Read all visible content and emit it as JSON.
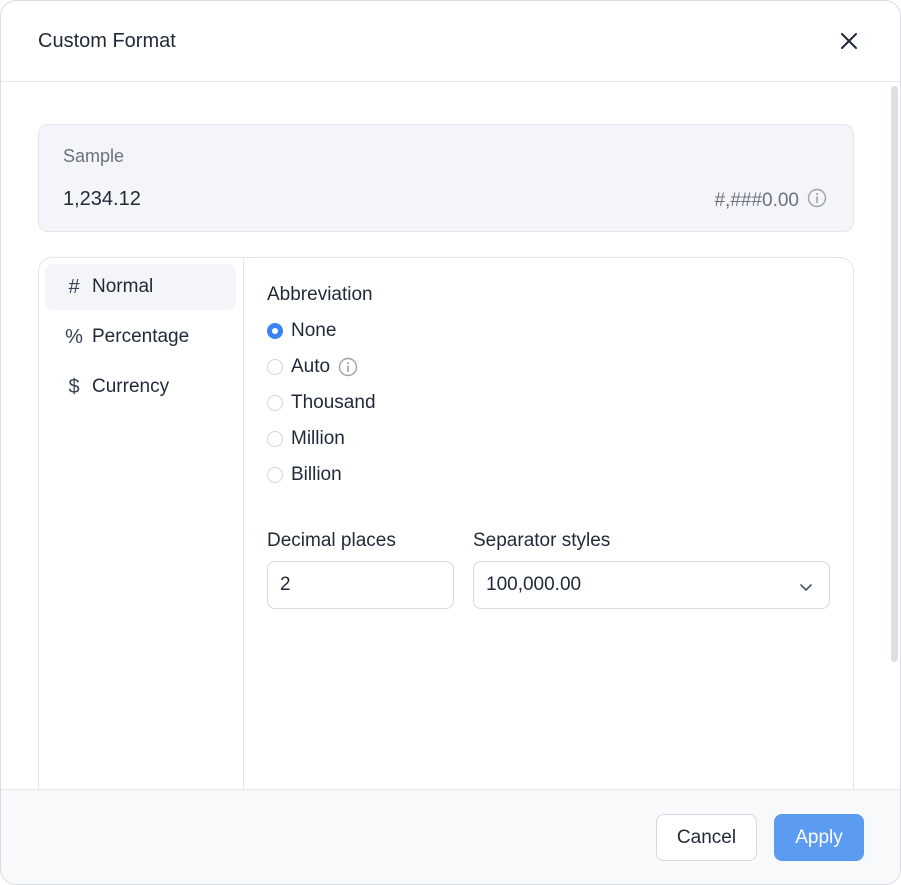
{
  "dialog": {
    "title": "Custom Format"
  },
  "sample": {
    "label": "Sample",
    "value": "1,234.12",
    "format": "#,###0.00"
  },
  "sidebar": {
    "items": [
      {
        "icon": "#",
        "label": "Normal",
        "active": true
      },
      {
        "icon": "%",
        "label": "Percentage",
        "active": false
      },
      {
        "icon": "$",
        "label": "Currency",
        "active": false
      }
    ]
  },
  "abbreviation": {
    "title": "Abbreviation",
    "options": [
      {
        "label": "None",
        "checked": true
      },
      {
        "label": "Auto",
        "checked": false
      },
      {
        "label": "Thousand",
        "checked": false
      },
      {
        "label": "Million",
        "checked": false
      },
      {
        "label": "Billion",
        "checked": false
      }
    ]
  },
  "decimal": {
    "label": "Decimal places",
    "value": "2"
  },
  "separator": {
    "label": "Separator styles",
    "value": "100,000.00"
  },
  "footer": {
    "cancel_label": "Cancel",
    "apply_label": "Apply"
  },
  "colors": {
    "accent": "#3b82f6",
    "apply_button": "#5b9bf1",
    "panel_bg": "#f3f5f8"
  }
}
